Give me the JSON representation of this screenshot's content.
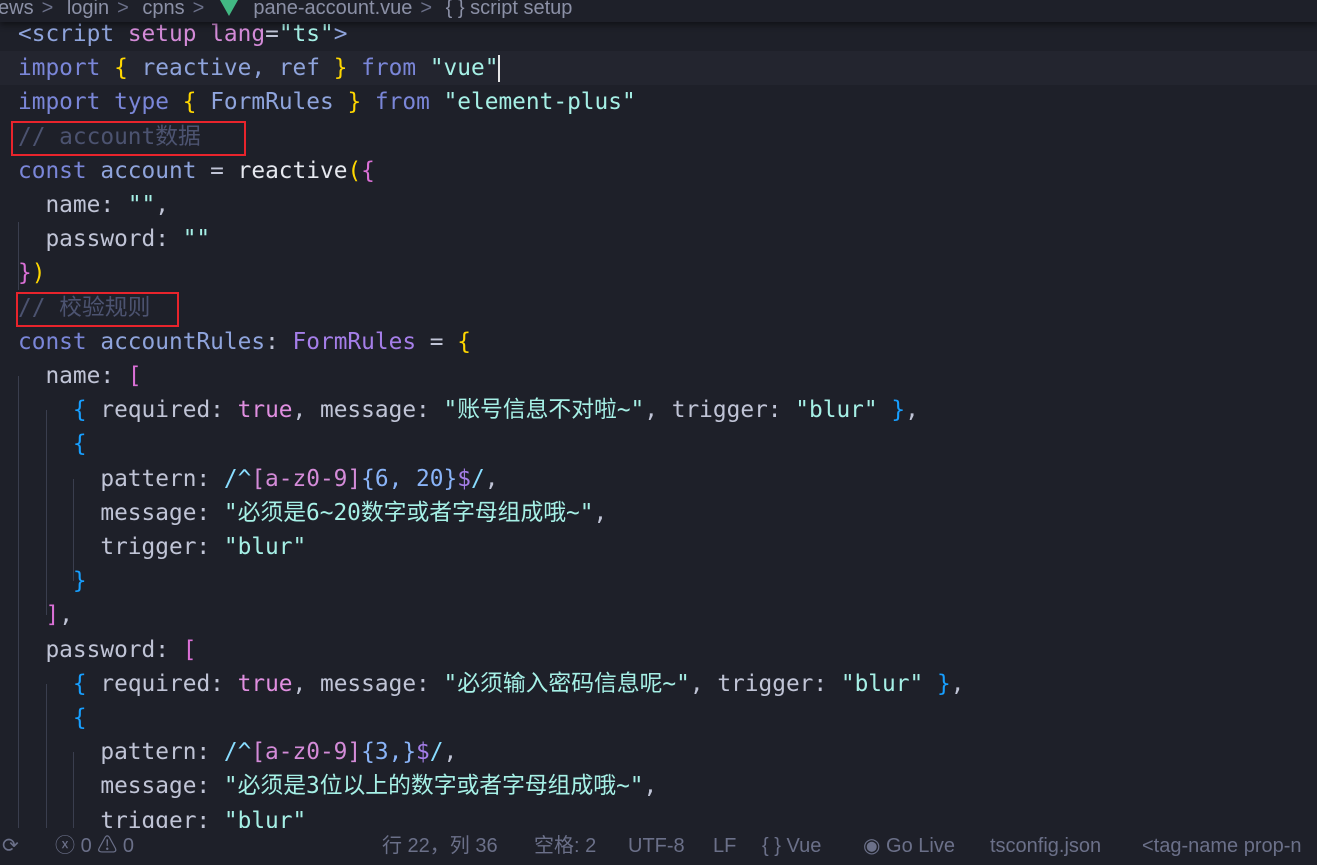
{
  "breadcrumb": {
    "items": [
      "ews",
      "login",
      "cpns",
      "pane-account.vue",
      "{ } script setup"
    ],
    "separator": ">"
  },
  "editor": {
    "current_line_index": 1,
    "lines": [
      [
        [
          "<",
          "tag"
        ],
        [
          "script",
          "tag"
        ],
        [
          " ",
          ""
        ],
        [
          "setup",
          "attr"
        ],
        [
          " ",
          ""
        ],
        [
          "lang",
          "attr"
        ],
        [
          "=",
          "pun"
        ],
        [
          "\"ts\"",
          "str"
        ],
        [
          ">",
          "tag"
        ]
      ],
      [
        [
          "import",
          "kw"
        ],
        [
          " ",
          ""
        ],
        [
          "{",
          "b1"
        ],
        [
          " reactive, ref ",
          "id"
        ],
        [
          "}",
          "b1"
        ],
        [
          " ",
          ""
        ],
        [
          "from",
          "kw"
        ],
        [
          " ",
          ""
        ],
        [
          "\"vue\"",
          "str"
        ]
      ],
      [
        [
          "import",
          "kw"
        ],
        [
          " ",
          ""
        ],
        [
          "type",
          "kw"
        ],
        [
          " ",
          ""
        ],
        [
          "{",
          "b1"
        ],
        [
          " FormRules ",
          "id"
        ],
        [
          "}",
          "b1"
        ],
        [
          " ",
          ""
        ],
        [
          "from",
          "kw"
        ],
        [
          " ",
          ""
        ],
        [
          "\"element-plus\"",
          "str"
        ]
      ],
      [
        [
          "// account数据",
          "com"
        ]
      ],
      [
        [
          "const",
          "kw"
        ],
        [
          " ",
          ""
        ],
        [
          "account",
          "id"
        ],
        [
          " = ",
          "pun"
        ],
        [
          "reactive",
          "fn"
        ],
        [
          "(",
          "b1"
        ],
        [
          "{",
          "b2"
        ]
      ],
      [
        [
          "  name: ",
          "prop"
        ],
        [
          "\"\"",
          "str"
        ],
        [
          ",",
          "pun"
        ]
      ],
      [
        [
          "  password: ",
          "prop"
        ],
        [
          "\"\"",
          "str"
        ]
      ],
      [
        [
          "}",
          "b2"
        ],
        [
          ")",
          "b1"
        ]
      ],
      [
        [
          "// 校验规则",
          "com"
        ]
      ],
      [
        [
          "const",
          "kw"
        ],
        [
          " ",
          ""
        ],
        [
          "accountRules",
          "id"
        ],
        [
          ": ",
          "pun"
        ],
        [
          "FormRules",
          "type"
        ],
        [
          " = ",
          "pun"
        ],
        [
          "{",
          "b1"
        ]
      ],
      [
        [
          "  name: ",
          "prop"
        ],
        [
          "[",
          "b2"
        ]
      ],
      [
        [
          "    ",
          ""
        ],
        [
          "{",
          "b3"
        ],
        [
          " required: ",
          "prop"
        ],
        [
          "true",
          "bool"
        ],
        [
          ", message: ",
          "prop"
        ],
        [
          "\"账号信息不对啦~\"",
          "str"
        ],
        [
          ", trigger: ",
          "prop"
        ],
        [
          "\"blur\"",
          "str"
        ],
        [
          " ",
          ""
        ],
        [
          "}",
          "b3"
        ],
        [
          ",",
          "pun"
        ]
      ],
      [
        [
          "    ",
          ""
        ],
        [
          "{",
          "b3"
        ]
      ],
      [
        [
          "      pattern: ",
          "prop"
        ],
        [
          "/^",
          "re"
        ],
        [
          "[a-z0-9]",
          "rec"
        ],
        [
          "{6, 20}",
          "req"
        ],
        [
          "$",
          "red"
        ],
        [
          "/",
          "re"
        ],
        [
          ",",
          "pun"
        ]
      ],
      [
        [
          "      message: ",
          "prop"
        ],
        [
          "\"必须是6~20数字或者字母组成哦~\"",
          "str"
        ],
        [
          ",",
          "pun"
        ]
      ],
      [
        [
          "      trigger: ",
          "prop"
        ],
        [
          "\"blur\"",
          "str"
        ]
      ],
      [
        [
          "    ",
          ""
        ],
        [
          "}",
          "b3"
        ]
      ],
      [
        [
          "  ",
          ""
        ],
        [
          "]",
          "b2"
        ],
        [
          ",",
          "pun"
        ]
      ],
      [
        [
          "  password: ",
          "prop"
        ],
        [
          "[",
          "b2"
        ]
      ],
      [
        [
          "    ",
          ""
        ],
        [
          "{",
          "b3"
        ],
        [
          " required: ",
          "prop"
        ],
        [
          "true",
          "bool"
        ],
        [
          ", message: ",
          "prop"
        ],
        [
          "\"必须输入密码信息呢~\"",
          "str"
        ],
        [
          ", trigger: ",
          "prop"
        ],
        [
          "\"blur\"",
          "str"
        ],
        [
          " ",
          ""
        ],
        [
          "}",
          "b3"
        ],
        [
          ",",
          "pun"
        ]
      ],
      [
        [
          "    ",
          ""
        ],
        [
          "{",
          "b3"
        ]
      ],
      [
        [
          "      pattern: ",
          "prop"
        ],
        [
          "/^",
          "re"
        ],
        [
          "[a-z0-9]",
          "rec"
        ],
        [
          "{3,}",
          "req"
        ],
        [
          "$",
          "red"
        ],
        [
          "/",
          "re"
        ],
        [
          ",",
          "pun"
        ]
      ],
      [
        [
          "      message: ",
          "prop"
        ],
        [
          "\"必须是3位以上的数字或者字母组成哦~\"",
          "str"
        ],
        [
          ",",
          "pun"
        ]
      ],
      [
        [
          "      trigger: ",
          "prop"
        ],
        [
          "\"blur\"",
          "str"
        ]
      ]
    ]
  },
  "status": {
    "sync_icon": "sync-icon",
    "errors": "0",
    "warnings": "0",
    "position": "行 22，列 36",
    "indent": "空格: 2",
    "encoding": "UTF-8",
    "eol": "LF",
    "language": "Vue",
    "go_live": "Go Live",
    "tsconfig": "tsconfig.json",
    "tag_name": "<tag-name prop-n"
  },
  "colors": {
    "background": "#1e2029",
    "annotation_box": "#e8242c",
    "string": "#a6f0e6",
    "keyword": "#7a86d8"
  }
}
